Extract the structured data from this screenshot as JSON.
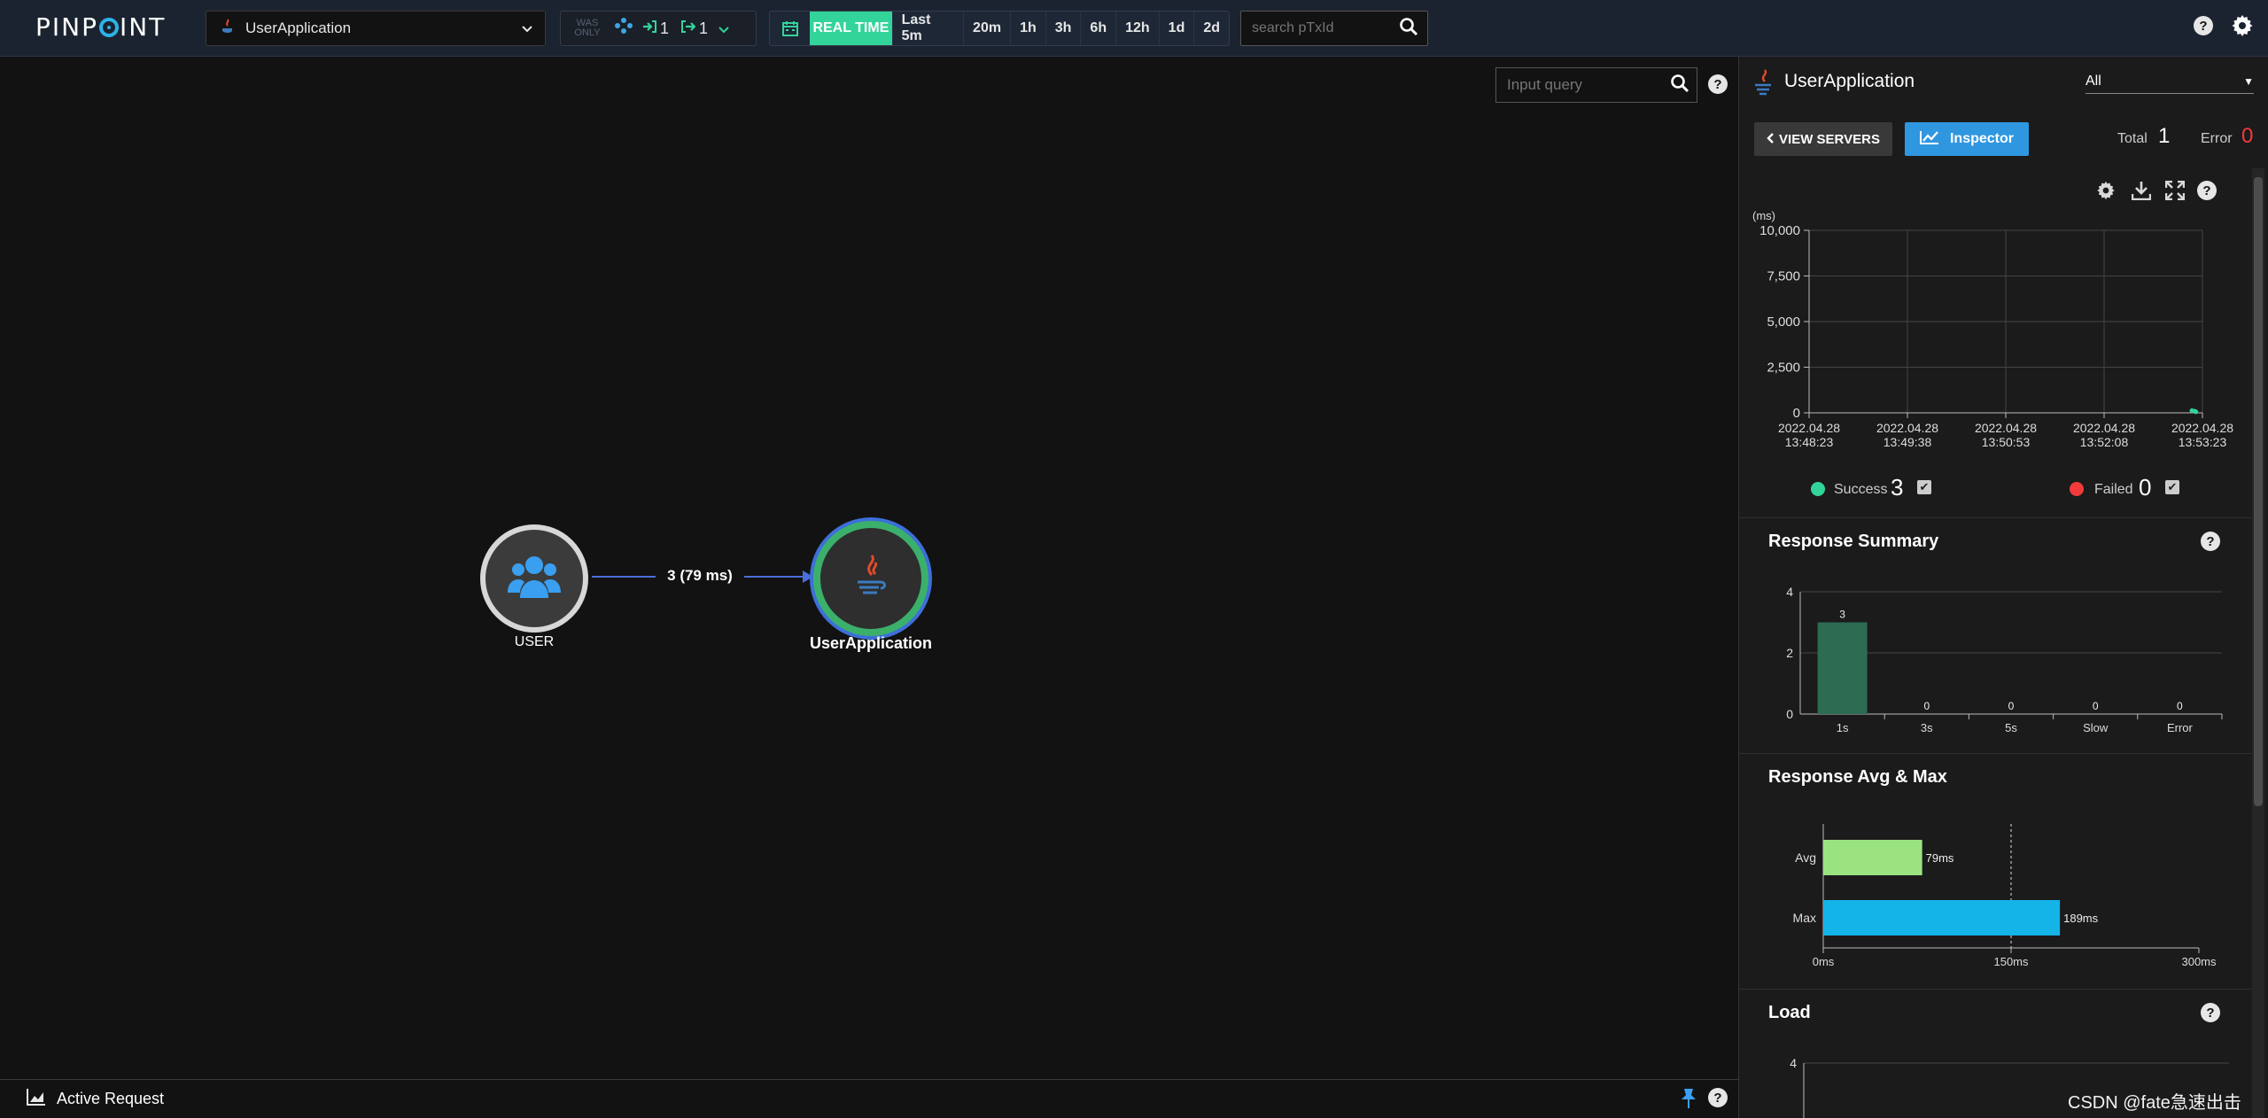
{
  "header": {
    "logo": "PINPOINT",
    "app_select": {
      "value": "UserApplication",
      "icon": "java-icon"
    },
    "was_only": "WAS ONLY",
    "inbound_count": "1",
    "outbound_count": "1",
    "time_buttons": [
      "REAL TIME",
      "Last 5m",
      "20m",
      "1h",
      "3h",
      "6h",
      "12h",
      "1d",
      "2d"
    ],
    "txid_placeholder": "search pTxId",
    "accent_color": "#33d49a"
  },
  "map": {
    "query_placeholder": "Input query",
    "nodes": [
      {
        "label": "USER",
        "icon": "users-icon"
      },
      {
        "label": "UserApplication",
        "icon": "java-icon"
      }
    ],
    "edge_label": "3 (79 ms)"
  },
  "bottom": {
    "label": "Active Request"
  },
  "panel": {
    "title": "UserApplication",
    "filter": "All",
    "view_servers": "VIEW SERVERS",
    "inspector": "Inspector",
    "total_label": "Total",
    "total_value": "1",
    "error_label": "Error",
    "error_value": "0",
    "success_label": "Success",
    "success_value": "3",
    "failed_label": "Failed",
    "failed_value": "0",
    "response_summary_title": "Response Summary",
    "response_avg_max_title": "Response Avg & Max",
    "load_title": "Load"
  },
  "watermark": "CSDN @fate急速出击",
  "chart_data": [
    {
      "type": "scatter",
      "ylabel": "(ms)",
      "y_ticks": [
        "10,000",
        "7,500",
        "5,000",
        "2,500",
        "0"
      ],
      "ylim": [
        0,
        10000
      ],
      "x_ticks": [
        [
          "2022.04.28",
          "13:48:23"
        ],
        [
          "2022.04.28",
          "13:49:38"
        ],
        [
          "2022.04.28",
          "13:50:53"
        ],
        [
          "2022.04.28",
          "13:52:08"
        ],
        [
          "2022.04.28",
          "13:53:23"
        ]
      ],
      "grid": true,
      "points": [
        {
          "x": "13:53:15",
          "y": 120
        },
        {
          "x": "13:53:17",
          "y": 90
        },
        {
          "x": "13:53:18",
          "y": 60
        }
      ]
    },
    {
      "type": "bar",
      "title": "Response Summary",
      "categories": [
        "1s",
        "3s",
        "5s",
        "Slow",
        "Error"
      ],
      "values": [
        3,
        0,
        0,
        0,
        0
      ],
      "y_ticks": [
        "4",
        "2",
        "0"
      ],
      "ylim": [
        0,
        4
      ],
      "color": "#2d6b53"
    },
    {
      "type": "bar",
      "title": "Response Avg & Max",
      "orientation": "horizontal",
      "categories": [
        "Avg",
        "Max"
      ],
      "values": [
        79,
        189
      ],
      "value_labels": [
        "79ms",
        "189ms"
      ],
      "colors": [
        "#9be381",
        "#14b4e8"
      ],
      "x_ticks": [
        "0ms",
        "150ms",
        "300ms"
      ],
      "xlim": [
        0,
        300
      ],
      "reference_line": 150
    },
    {
      "type": "bar",
      "title": "Load",
      "y_ticks": [
        "4"
      ],
      "ylim": [
        0,
        4
      ]
    }
  ]
}
